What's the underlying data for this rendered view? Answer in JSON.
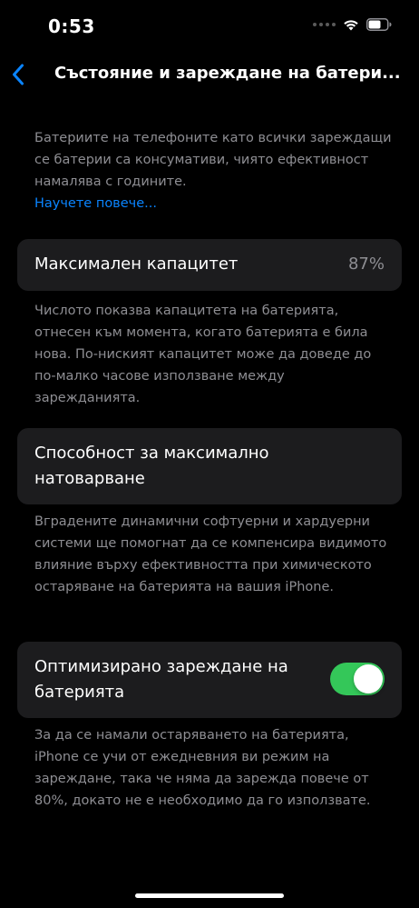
{
  "status_bar": {
    "time": "0:53",
    "icons": [
      "signal-dots-icon",
      "wifi-icon",
      "battery-icon"
    ]
  },
  "nav": {
    "back_icon": "chevron-left-icon",
    "title": "Състояние и зареждане на батери..."
  },
  "intro": {
    "text": "Батериите на телефоните като всички зареждащи се батерии са консумативи, чиято ефективност намалява с годините.",
    "link": "Научете повече..."
  },
  "capacity": {
    "label": "Максимален капацитет",
    "value": "87%",
    "note": "Числото показва капацитета на батерията, отнесен към момента, когато батерията е била нова. По-ниският капацитет може да доведе до по-малко часове използване между зарежданията."
  },
  "peak": {
    "label": "Способност за максимално натоварване",
    "note": "Вградените динамични софтуерни и хардуерни системи ще помогнат да се компенсира видимото влияние върху ефективността при химическото остаряване на батерията на вашия iPhone."
  },
  "optimized": {
    "label": "Оптимизирано зареждане на батерията",
    "toggle_on": true,
    "note": "За да се намали остаряването на батерията, iPhone се учи от ежедневния ви режим на зареждане, така че няма да зарежда повече от 80%, докато не е необходимо да го използвате."
  },
  "colors": {
    "background": "#000000",
    "card": "#1c1c1e",
    "accent": "#0a84ff",
    "toggle_on": "#34c759",
    "secondary_text": "#8e8e93"
  }
}
